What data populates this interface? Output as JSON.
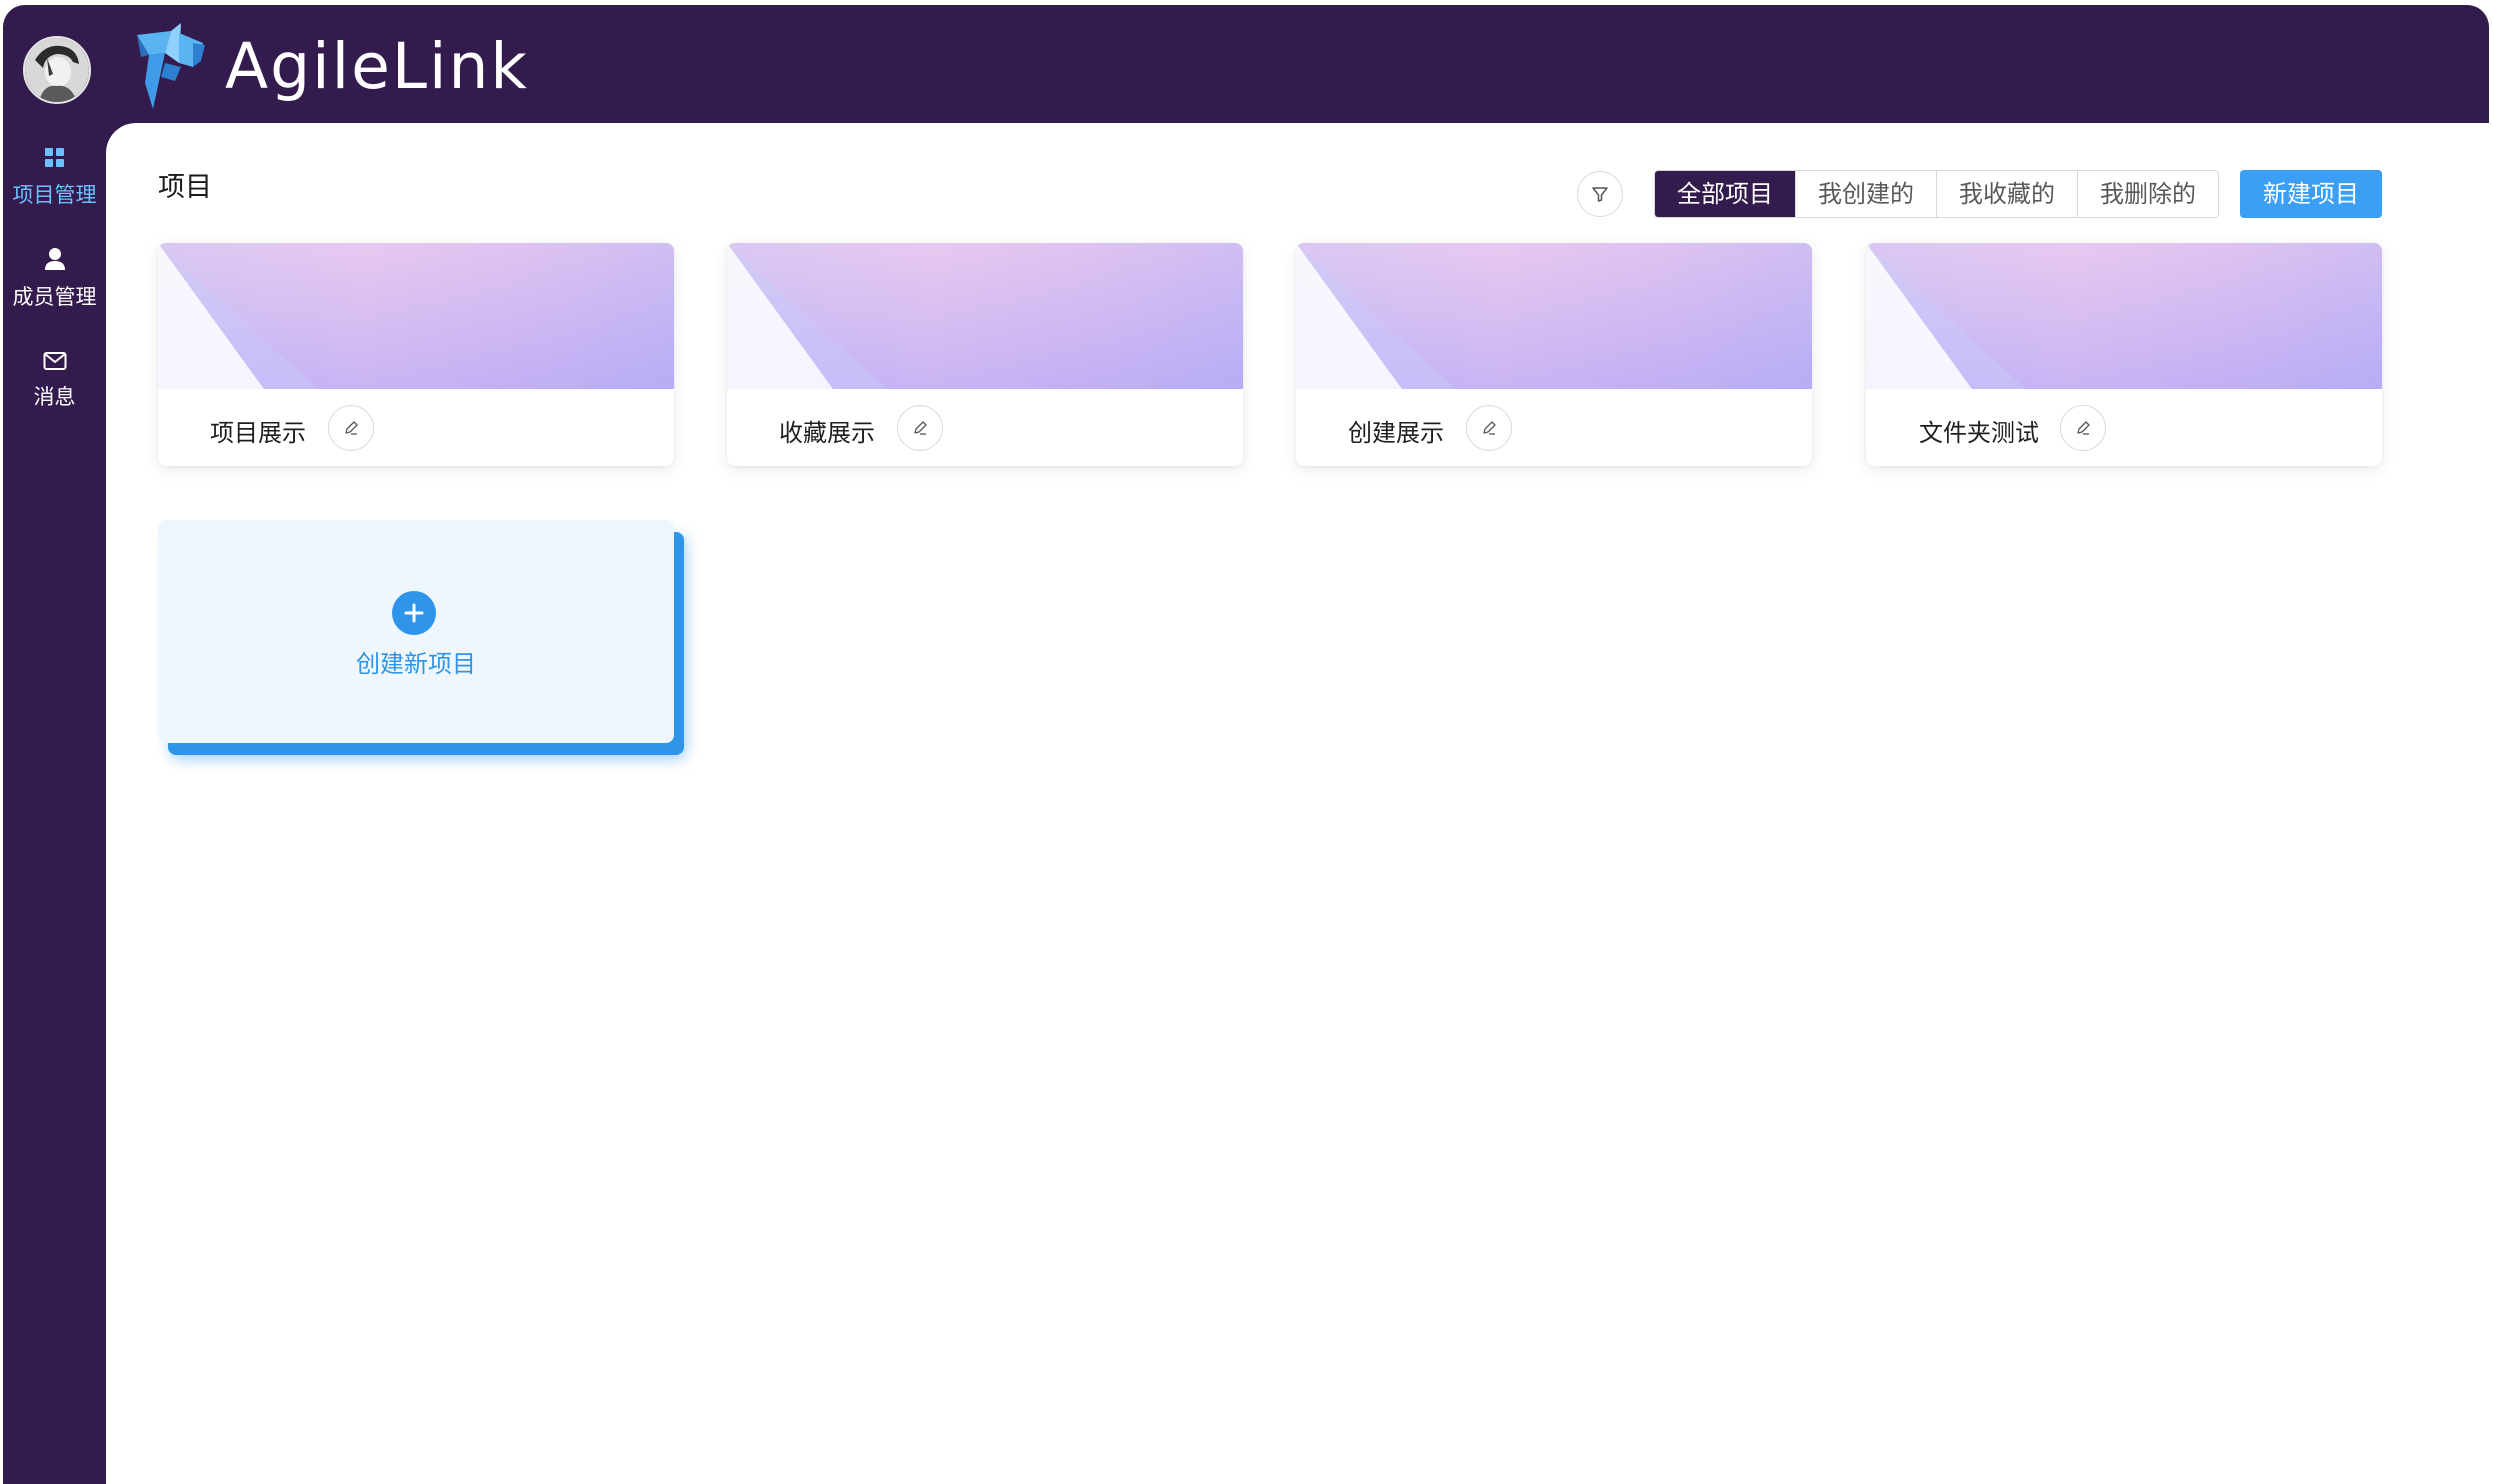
{
  "header": {
    "brand": "AgileLink",
    "avatar_icon": "user-avatar",
    "logo_icon": "agilelink-logo"
  },
  "sidebar": {
    "items": [
      {
        "label": "项目管理",
        "icon": "grid-icon",
        "active": true
      },
      {
        "label": "成员管理",
        "icon": "user-icon",
        "active": false
      },
      {
        "label": "消息",
        "icon": "mail-icon",
        "active": false
      }
    ]
  },
  "main": {
    "title": "项目",
    "filter_icon": "filter-icon",
    "tabs": [
      {
        "label": "全部项目",
        "active": true
      },
      {
        "label": "我创建的",
        "active": false
      },
      {
        "label": "我收藏的",
        "active": false
      },
      {
        "label": "我删除的",
        "active": false
      }
    ],
    "new_project_label": "新建项目",
    "projects": [
      {
        "name": "项目展示",
        "edit_icon": "pencil-icon"
      },
      {
        "name": "收藏展示",
        "edit_icon": "pencil-icon"
      },
      {
        "name": "创建展示",
        "edit_icon": "pencil-icon"
      },
      {
        "name": "文件夹测试",
        "edit_icon": "pencil-icon"
      }
    ],
    "create_card": {
      "label": "创建新项目",
      "icon": "plus-icon"
    }
  },
  "colors": {
    "frame": "#331b4d",
    "accent": "#3a9ff5",
    "active_nav": "#6cc2ff",
    "create_blue": "#2f95ea"
  }
}
